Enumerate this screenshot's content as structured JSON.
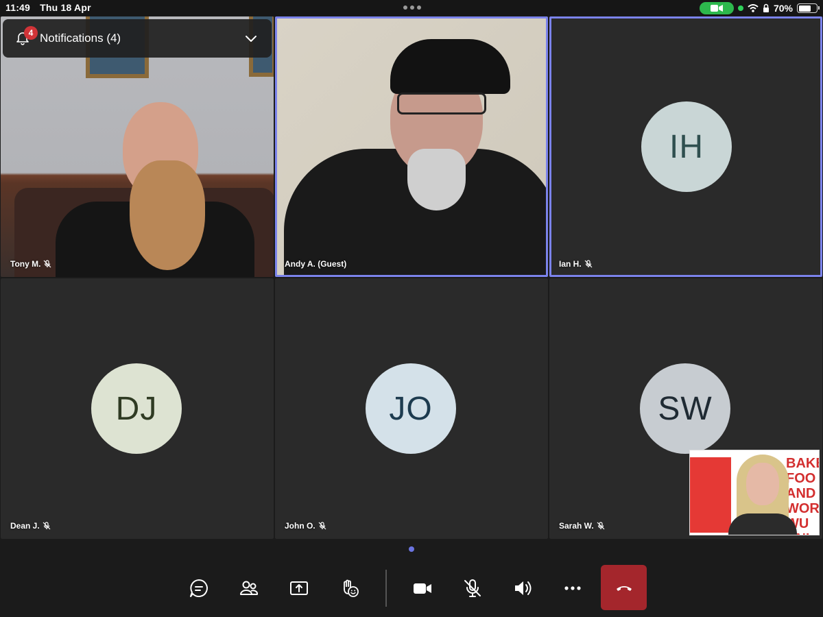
{
  "status_bar": {
    "time": "11:49",
    "date": "Thu 18 Apr",
    "battery_percent": "70%",
    "battery_level": 0.7
  },
  "notifications": {
    "title": "Notifications (4)",
    "badge_count": "4"
  },
  "participants": [
    {
      "name": "Tony M.",
      "initials": "",
      "muted": true,
      "video": true,
      "active": false
    },
    {
      "name": "Andy A. (Guest)",
      "initials": "",
      "muted": false,
      "video": true,
      "active": true
    },
    {
      "name": "Ian H.",
      "initials": "IH",
      "muted": true,
      "video": false,
      "active": true,
      "avatar_bg": "#c9d6d6",
      "avatar_fg": "#2f4f4f"
    },
    {
      "name": "Dean J.",
      "initials": "DJ",
      "muted": true,
      "video": false,
      "active": false,
      "avatar_bg": "#dde3d2",
      "avatar_fg": "#2f3b23"
    },
    {
      "name": "John O.",
      "initials": "JO",
      "muted": true,
      "video": false,
      "active": false,
      "avatar_bg": "#d4e1e9",
      "avatar_fg": "#1d3b4f"
    },
    {
      "name": "Sarah W.",
      "initials": "SW",
      "muted": true,
      "video": false,
      "active": false,
      "avatar_bg": "#c7ccd1",
      "avatar_fg": "#1f2a33"
    }
  ],
  "self_view": {
    "poster_text": "BAKE\nFOO\nAND A\nWORK\nWU\nUNI"
  },
  "toolbar": {
    "buttons": [
      "chat-icon",
      "people-icon",
      "share-icon",
      "raise-hand-icon",
      "camera-icon",
      "mic-off-icon",
      "speaker-icon",
      "more-icon",
      "hangup-icon"
    ]
  },
  "colors": {
    "accent": "#7b83eb",
    "hangup": "#a4262c",
    "badge": "#d13438",
    "camera_pill": "#2db84d"
  }
}
